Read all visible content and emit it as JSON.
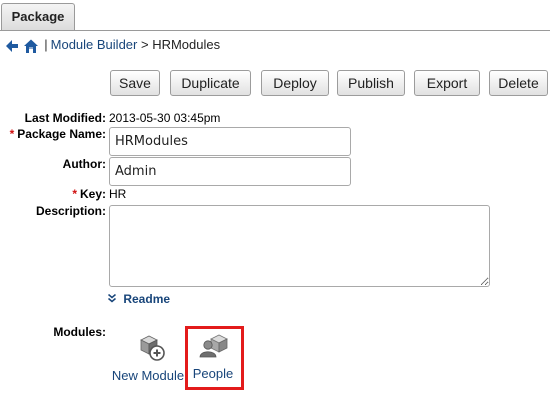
{
  "tab": {
    "label": "Package"
  },
  "breadcrumb": {
    "back_icon": "back-arrow-icon",
    "home_icon": "home-icon",
    "separator": "|",
    "link": "Module Builder",
    "arrow": ">",
    "current": "HRModules"
  },
  "toolbar": {
    "save": "Save",
    "duplicate": "Duplicate",
    "deploy": "Deploy",
    "publish": "Publish",
    "export": "Export",
    "delete": "Delete"
  },
  "form": {
    "last_modified_label": "Last Modified:",
    "last_modified_value": "2013-05-30 03:45pm",
    "package_name_label": "Package Name:",
    "package_name_value": "HRModules",
    "author_label": "Author:",
    "author_value": "Admin",
    "key_label": "Key:",
    "key_value": "HR",
    "description_label": "Description:",
    "description_value": "",
    "required_marker": "*",
    "readme_label": "Readme"
  },
  "modules": {
    "label": "Modules:",
    "items": [
      {
        "label": "New Module",
        "icon": "new-module-icon"
      },
      {
        "label": "People",
        "icon": "people-module-icon",
        "highlighted": true
      }
    ],
    "highlight_color": "#e31b1b"
  },
  "colors": {
    "link": "#18457a",
    "required": "#d01010"
  }
}
